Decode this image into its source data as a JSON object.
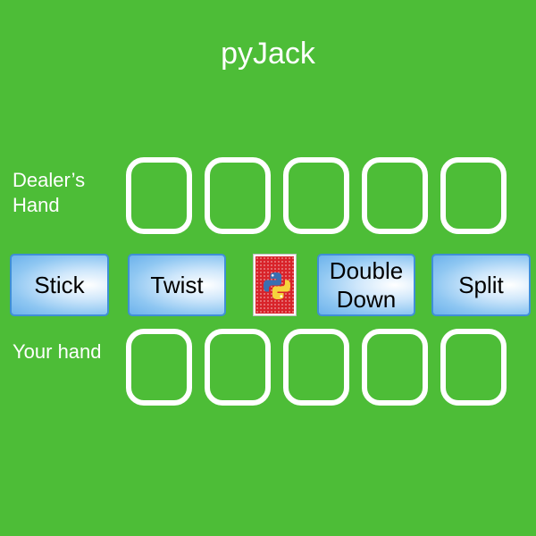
{
  "app": {
    "title": "pyJack",
    "background_color": "#4dbd37"
  },
  "labels": {
    "dealer_line1": "Dealer’s",
    "dealer_line2": "Hand",
    "player": "Your hand"
  },
  "dealer_slots": 5,
  "player_slots": 5,
  "buttons": {
    "stick": "Stick",
    "twist": "Twist",
    "double_line1": "Double",
    "double_line2": "Down",
    "split": "Split"
  },
  "deck": {
    "icon": "python-logo-icon",
    "back_color": "#d8232a"
  }
}
